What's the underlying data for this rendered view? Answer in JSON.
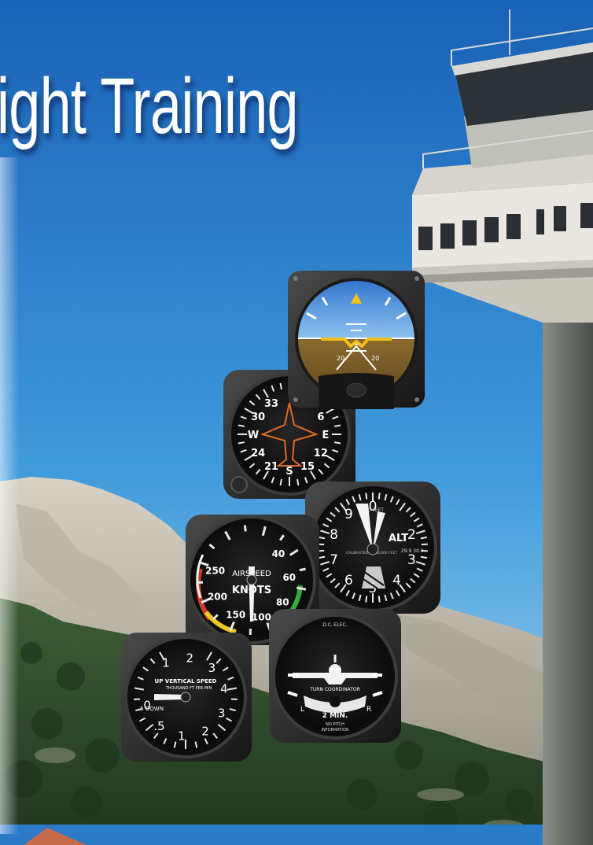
{
  "page": {
    "title": "ight Training"
  },
  "instruments": {
    "attitude_indicator": {
      "scale_left": "20",
      "scale_right": "20",
      "pitch_marks": [
        "10",
        "10"
      ]
    },
    "heading_indicator": {
      "labels": [
        "33",
        "30",
        "W",
        "24",
        "21",
        "S",
        "15",
        "12",
        "E",
        "6"
      ]
    },
    "altimeter": {
      "numbers": [
        "0",
        "9",
        "8",
        "7",
        "6",
        "5",
        "4",
        "3",
        "2"
      ],
      "caption": "ALT",
      "kollsman": "29.9 30.0",
      "small": "CALIBRATED TO 20,000 FEET",
      "top": "100 FEET"
    },
    "airspeed_indicator": {
      "label_top": "AIRSPEED",
      "label_unit": "KNOTS",
      "scale": [
        "40",
        "60",
        "80",
        "100",
        "150",
        "200",
        "250"
      ]
    },
    "turn_coordinator": {
      "top_label": "D.C. ELEC.",
      "title": "TURN COORDINATOR",
      "left": "L",
      "right": "R",
      "timing": "2 MIN.",
      "note1": "NO PITCH",
      "note2": "INFORMATION"
    },
    "vertical_speed_indicator": {
      "up": "UP VERTICAL SPEED",
      "unit": "THOUSAND FT PER MIN",
      "down": ".5 DOWN",
      "numbers": [
        "1",
        "2",
        "3",
        "4",
        "3",
        "2",
        "1",
        ".5",
        "0"
      ]
    }
  },
  "colors": {
    "sky_top": "#1966bb",
    "sky_bottom": "#7fc0e6",
    "mountain": "#c7c0b0",
    "forest": "#2f4d2c",
    "tower": "#e8e6dd",
    "tower_shadow": "#6f7370"
  }
}
